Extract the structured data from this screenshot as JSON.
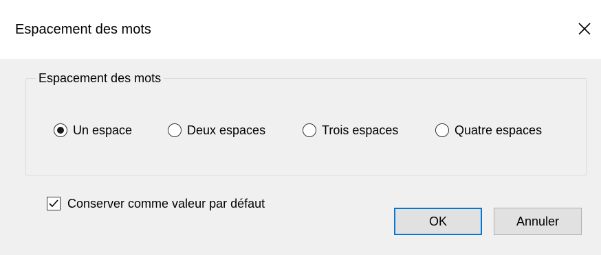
{
  "dialog": {
    "title": "Espacement des mots",
    "close_icon": "close-icon"
  },
  "group": {
    "legend": "Espacement des mots",
    "options": [
      {
        "label": "Un espace",
        "selected": true
      },
      {
        "label": "Deux espaces",
        "selected": false
      },
      {
        "label": "Trois espaces",
        "selected": false
      },
      {
        "label": "Quatre espaces",
        "selected": false
      }
    ]
  },
  "default_checkbox": {
    "label": "Conserver comme valeur par défaut",
    "checked": true
  },
  "buttons": {
    "ok": "OK",
    "cancel": "Annuler"
  },
  "colors": {
    "client_bg": "#f0f0f0",
    "default_button_border": "#0078d7"
  }
}
